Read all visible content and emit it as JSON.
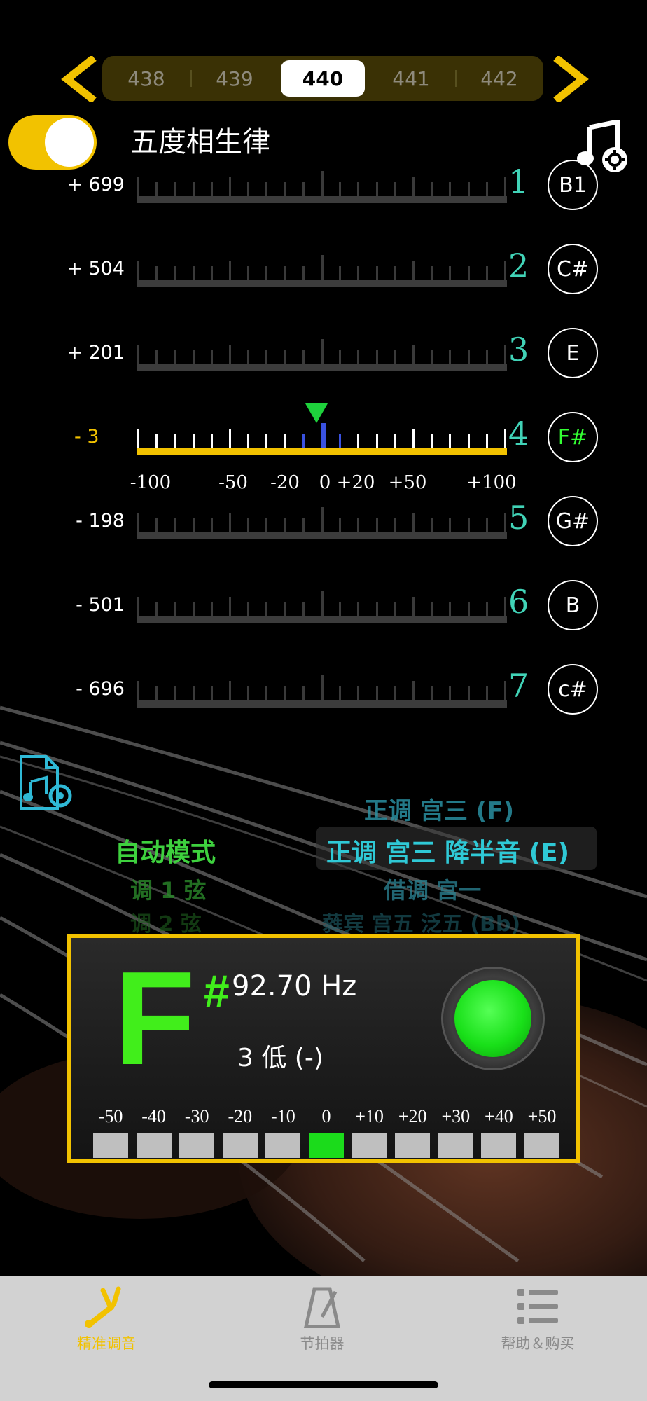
{
  "freq_selector": {
    "options": [
      "438",
      "439",
      "440",
      "441",
      "442"
    ],
    "selected": "440"
  },
  "temperament_label": "五度相生律",
  "strings": [
    {
      "num": "1",
      "note": "B1",
      "cents": "+ 699"
    },
    {
      "num": "2",
      "note": "C#",
      "cents": "+ 504"
    },
    {
      "num": "3",
      "note": "E",
      "cents": "+ 201"
    },
    {
      "num": "4",
      "note": "F#",
      "cents": "- 3",
      "active": true
    },
    {
      "num": "5",
      "note": "G#",
      "cents": "- 198"
    },
    {
      "num": "6",
      "note": "B",
      "cents": "- 501"
    },
    {
      "num": "7",
      "note": "c#",
      "cents": "- 696"
    }
  ],
  "scale_labels": [
    "-100",
    "-50",
    "-20",
    "0",
    "+20",
    "+50",
    "+100"
  ],
  "mode_picker": {
    "left": [
      "自动模式",
      "调 1 弦",
      "调 2 弦"
    ],
    "right": [
      "正调 宫三 (F)",
      "正调 宫三 降半音 (E)",
      "借调 宫一",
      "蕤宾 宫五 泛五 (Bb)"
    ],
    "selected_right": "正调 宫三 降半音 (E)"
  },
  "tuner": {
    "note": "F",
    "accidental": "#",
    "frequency": "92.70 Hz",
    "deviation": "3  低 (-)",
    "in_tune_color": "#1bdb1b",
    "steps": [
      "-50",
      "-40",
      "-30",
      "-20",
      "-10",
      "0",
      "+10",
      "+20",
      "+30",
      "+40",
      "+50"
    ],
    "active_step": "0"
  },
  "tabs": [
    {
      "label": "精准调音",
      "icon": "tuning-fork-icon",
      "active": true
    },
    {
      "label": "节拍器",
      "icon": "metronome-icon",
      "active": false
    },
    {
      "label": "帮助＆购买",
      "icon": "list-icon",
      "active": false
    }
  ],
  "colors": {
    "accent": "#f2c200",
    "string_number": "#41d3b7",
    "note_green": "#41ee1b"
  }
}
